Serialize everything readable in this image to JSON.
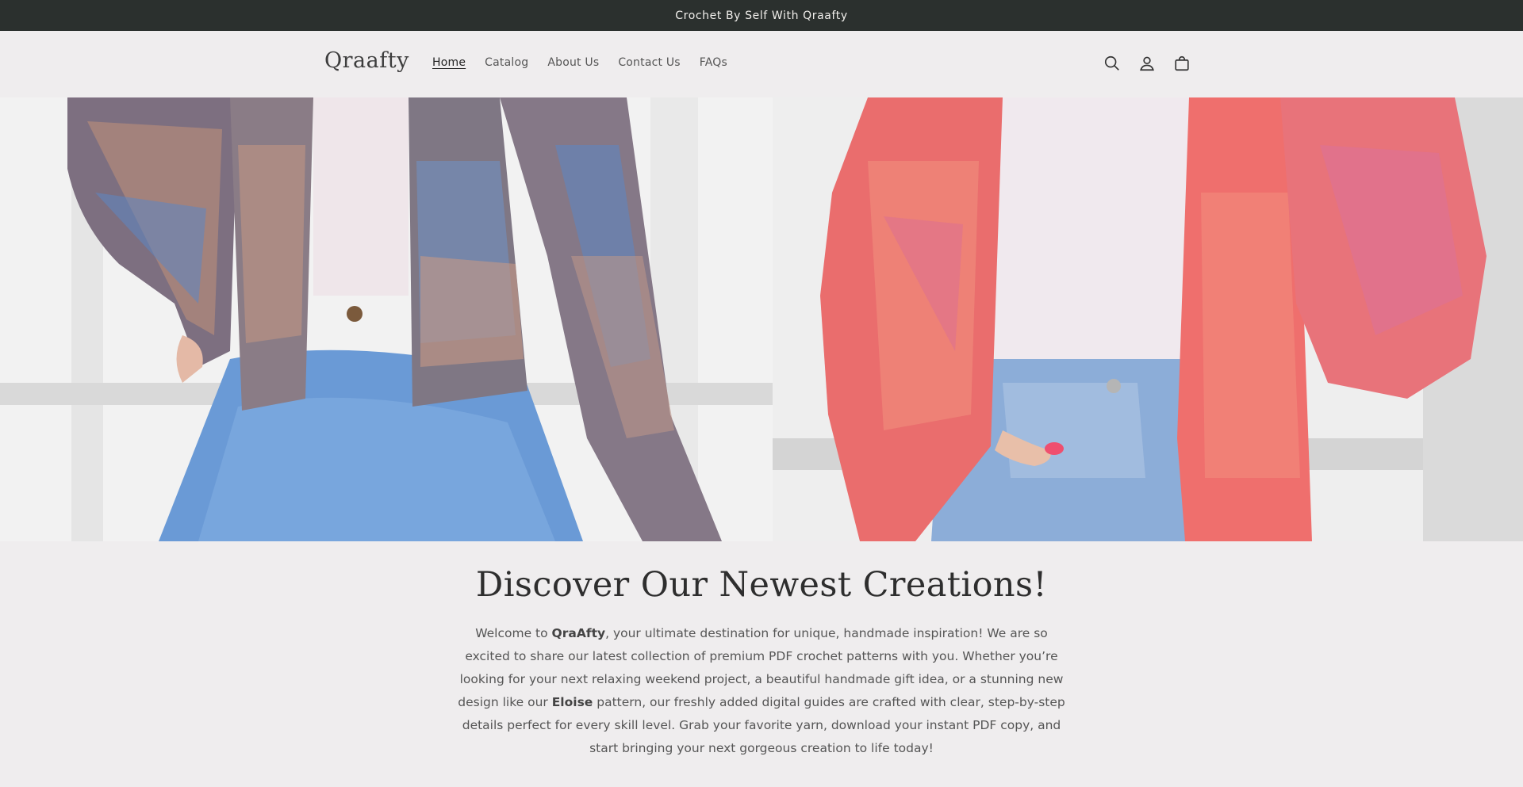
{
  "announcement": {
    "text": "Crochet By Self With Qraafty"
  },
  "header": {
    "logo": "Qraafty",
    "nav": [
      {
        "label": "Home",
        "active": true
      },
      {
        "label": "Catalog",
        "active": false
      },
      {
        "label": "About Us",
        "active": false
      },
      {
        "label": "Contact Us",
        "active": false
      },
      {
        "label": "FAQs",
        "active": false
      }
    ],
    "icons": [
      "search-icon",
      "account-icon",
      "cart-icon"
    ]
  },
  "hero": {
    "images": [
      "multicolor-crochet-cardigan-image",
      "pink-crochet-cardigan-image"
    ]
  },
  "main": {
    "headline": "Discover Our Newest Creations!",
    "intro": {
      "p1": "Welcome to ",
      "brand": "QraAfty",
      "p2": ", your ultimate destination for unique, handmade inspiration! We are so excited to share our latest collection of premium PDF crochet patterns with you. Whether you’re looking for your next relaxing weekend project, a beautiful handmade gift idea, or a stunning new design like our ",
      "pattern": "Eloise",
      "p3": " pattern, our freshly added digital guides are crafted with clear, step-by-step details perfect for every skill level. Grab your favorite yarn, download your instant PDF copy, and start bringing your next gorgeous creation to life today!"
    }
  },
  "colors": {
    "announcement_bg": "#2b302e",
    "page_bg": "#efedee",
    "text_dark": "#2e2e2e"
  }
}
